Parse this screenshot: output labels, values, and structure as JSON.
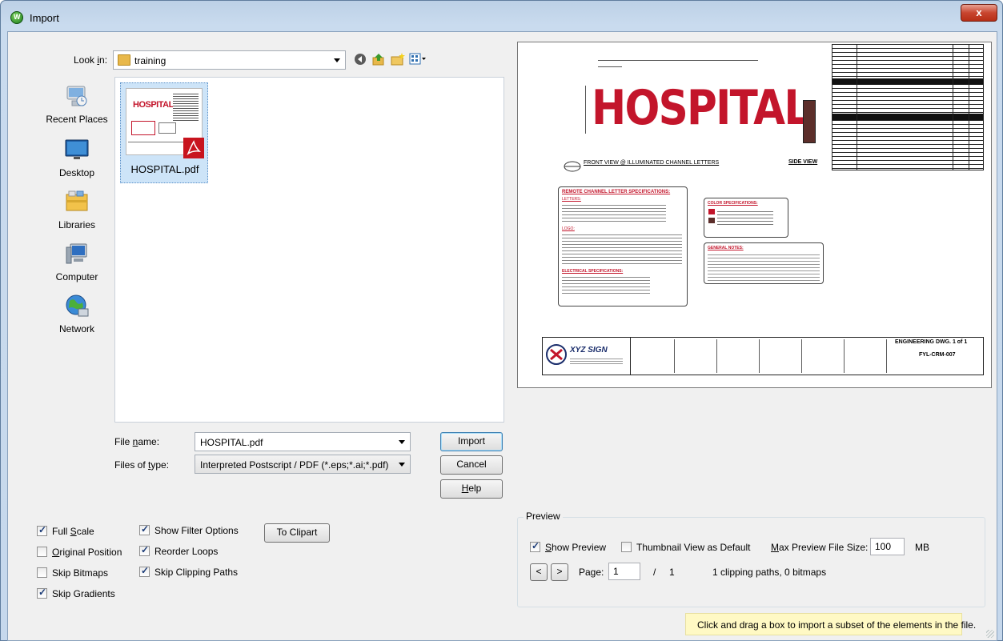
{
  "window": {
    "title": "Import",
    "close_glyph": "x"
  },
  "look_in": {
    "label_pre": "Look ",
    "label_u": "i",
    "label_post": "n:",
    "value": "training"
  },
  "places": [
    {
      "label": "Recent Places",
      "icon": "recent-places-icon"
    },
    {
      "label": "Desktop",
      "icon": "desktop-icon"
    },
    {
      "label": "Libraries",
      "icon": "libraries-icon"
    },
    {
      "label": "Computer",
      "icon": "computer-icon"
    },
    {
      "label": "Network",
      "icon": "network-icon"
    }
  ],
  "files": [
    {
      "name": "HOSPITAL.pdf",
      "thumb_text": "HOSPITAL"
    }
  ],
  "file_name": {
    "label_pre": "File ",
    "label_u": "n",
    "label_post": "ame:",
    "value": "HOSPITAL.pdf"
  },
  "files_of_type": {
    "label_pre": "Files of ",
    "label_u": "t",
    "label_post": "ype:",
    "value": "Interpreted Postscript / PDF (*.eps;*.ai;*.pdf)"
  },
  "buttons": {
    "import": "Import",
    "cancel": "Cancel",
    "help_u": "H",
    "help_rest": "elp",
    "to_clipart": "To Clipart"
  },
  "options": [
    {
      "label_u": "",
      "label_pre": "Full ",
      "label_mid": "S",
      "label_post": "cale",
      "checked": true
    },
    {
      "label_pre": "",
      "label_mid": "O",
      "label_post": "riginal Position",
      "checked": false
    },
    {
      "label_pre": "Skip Bitmaps",
      "label_mid": "",
      "label_post": "",
      "checked": false
    },
    {
      "label_pre": "Skip Gradients",
      "label_mid": "",
      "label_post": "",
      "checked": true
    },
    {
      "label_pre": "Show Filter Options",
      "label_mid": "",
      "label_post": "",
      "checked": true
    },
    {
      "label_pre": "Reorder Loops",
      "label_mid": "",
      "label_post": "",
      "checked": true
    },
    {
      "label_pre": "Skip Clipping Paths",
      "label_mid": "",
      "label_post": "",
      "checked": true
    }
  ],
  "preview_group": {
    "title": "Preview",
    "show_preview_u": "S",
    "show_preview_rest": "how Preview",
    "show_preview_checked": true,
    "thumbnail_default": "Thumbnail View as Default",
    "thumbnail_default_checked": false,
    "max_size_label_u": "M",
    "max_size_label_rest": "ax Preview File Size:",
    "max_size_value": "100",
    "max_size_unit": "MB",
    "page_label": "Page:",
    "page_value": "1",
    "page_sep": "/",
    "page_total": "1",
    "stats": "1 clipping paths, 0 bitmaps",
    "prev": "<",
    "next": ">"
  },
  "hint": "Click and drag a box to import a subset of the elements in the file.",
  "drawing": {
    "title": "HOSPITAL",
    "front_view": "FRONT VIEW @ ILLUMINATED CHANNEL LETTERS",
    "side_view": "SIDE VIEW",
    "spec_title": "REMOTE CHANNEL LETTER SPECIFICATIONS:",
    "letters": "LETTERS:",
    "logo": "LOGO:",
    "electrical": "ELECTRICAL SPECIFICATIONS:",
    "color_spec": "COLOR SPECIFICATIONS:",
    "general_notes": "GENERAL NOTES:",
    "company": "XYZ SIGN",
    "eng_dwg": "ENGINEERING DWG. 1 of 1",
    "dwg_no": "FYL-CRM-007",
    "colors": {
      "red": "#c3152b",
      "brown": "#5c2e2a",
      "gray": "#8a8a8a"
    }
  }
}
